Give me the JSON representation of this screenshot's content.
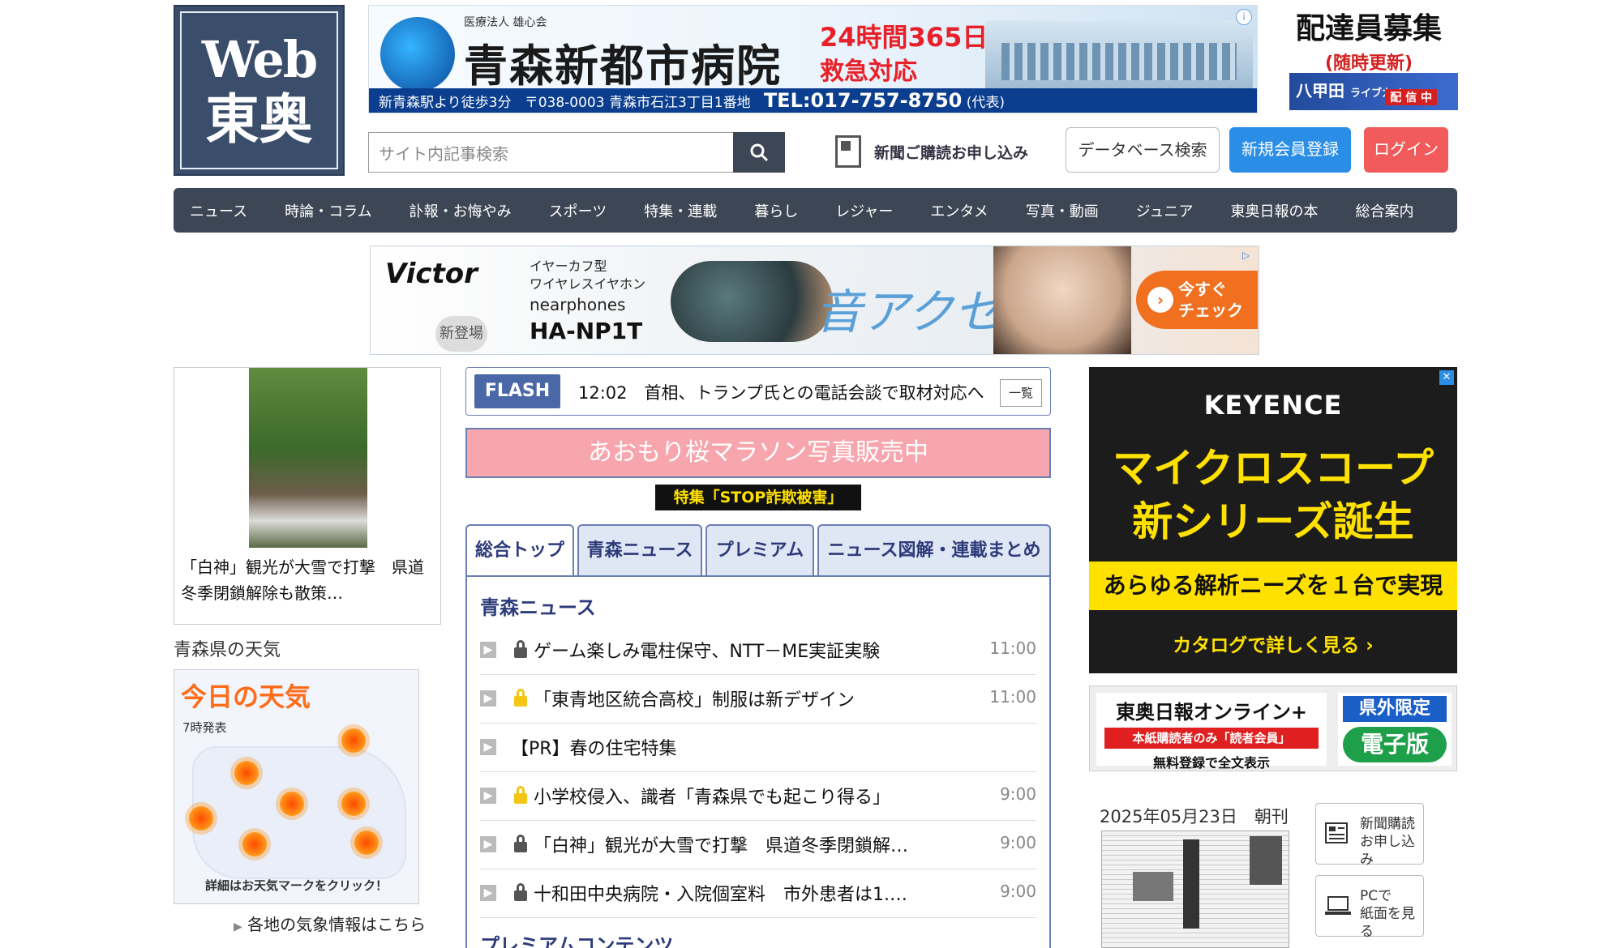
{
  "logo": {
    "line1": "Web",
    "line2": "東奥"
  },
  "ad_hospital": {
    "org": "医療法人 雄心会",
    "name": "青森新都市病院",
    "hours": "24時間365日",
    "emergency": "救急対応",
    "walk": "新青森駅より徒歩3分",
    "address": "〒038-0003 青森市石江3丁目1番地",
    "tel": "TEL:017-757-8750",
    "tel_note": "(代表)",
    "info_icon": "i"
  },
  "recruit": {
    "title": "配達員募集",
    "sub": "(随時更新)",
    "strip": "八甲田",
    "strip_small": "ライブカメ",
    "strip_tag": "配 信 中"
  },
  "search": {
    "placeholder": "サイト内記事検索"
  },
  "header_links": {
    "subscribe": "新聞ご購読お申し込み",
    "database": "データベース検索",
    "register": "新規会員登録",
    "login": "ログイン"
  },
  "nav": [
    "ニュース",
    "時論・コラム",
    "訃報・お悔やみ",
    "スポーツ",
    "特集・連載",
    "暮らし",
    "レジャー",
    "エンタメ",
    "写真・動画",
    "ジュニア",
    "東奥日報の本",
    "総合案内"
  ],
  "ad_victor": {
    "brand": "Victor",
    "new_label": "新登場",
    "desc1": "イヤーカフ型",
    "desc2": "ワイヤレスイヤホン",
    "product": "nearphones",
    "model": "HA-NP1T",
    "slogan": "音アクセ",
    "cta1": "今すぐ",
    "cta2": "チェック",
    "cta_icon": "›"
  },
  "left_card": {
    "caption": "「白神」観光が大雪で打撃　県道冬季閉鎖解除も散策…"
  },
  "weather": {
    "section_title": "青森県の天気",
    "title": "今日の天気",
    "published": "7時発表",
    "footer": "詳細はお天気マークをクリック！",
    "link": "各地の気象情報はこちら"
  },
  "flash": {
    "tag": "FLASH",
    "text": "12:02　首相、トランプ氏との電話会談で取材対応へ",
    "list_label": "一覧"
  },
  "marathon": "あおもり桜マラソン写真販売中",
  "fraud": "特集「STOP詐欺被害」",
  "tabs": [
    "総合トップ",
    "青森ニュース",
    "プレミアム",
    "ニュース図解・連載まとめ"
  ],
  "news": {
    "section": "青森ニュース",
    "items": [
      {
        "title": "ゲーム楽しみ電柱保守、NTT－ME実証実験",
        "time": "11:00",
        "lock": "grey"
      },
      {
        "title": "「東青地区統合高校」制服は新デザイン",
        "time": "11:00",
        "lock": "gold"
      },
      {
        "title": "【PR】春の住宅特集",
        "time": "",
        "lock": "none"
      },
      {
        "title": "小学校侵入、識者「青森県でも起こり得る」",
        "time": "9:00",
        "lock": "gold"
      },
      {
        "title": "「白神」観光が大雪で打撃　県道冬季閉鎖解…",
        "time": "9:00",
        "lock": "grey"
      },
      {
        "title": "十和田中央病院・入院個室料　市外患者は1.…",
        "time": "9:00",
        "lock": "grey"
      }
    ],
    "section2": "プレミアムコンテンツ"
  },
  "ad_keyence": {
    "logo": "KEYENCE",
    "headline1": "マイクロスコープ",
    "headline2": "新シリーズ誕生",
    "band": "あらゆる解析ニーズを１台で実現",
    "catalog": "カタログで詳しく見る ›",
    "close": "✕"
  },
  "online": {
    "title": "東奥日報オンライン+",
    "members": "本紙購読者のみ「読者会員」",
    "free": "無料登録で全文表示",
    "limited": "県外限定",
    "edition": "電子版"
  },
  "paper": {
    "date": "2025年05月23日　朝刊"
  },
  "side_buttons": [
    {
      "line1": "新聞購読",
      "line2": "お申し込み"
    },
    {
      "line1": "PCで",
      "line2": "紙面を見る"
    }
  ]
}
